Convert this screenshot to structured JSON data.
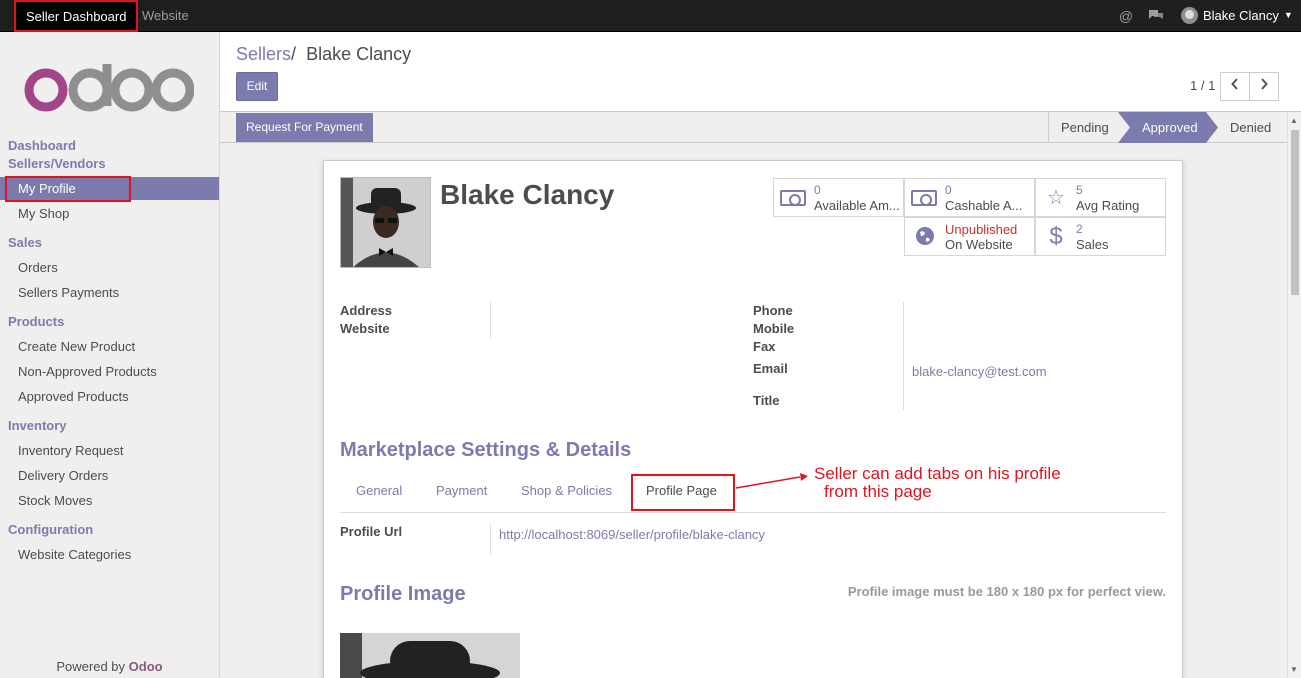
{
  "topbar": {
    "seller_dashboard": "Seller Dashboard",
    "website": "Website",
    "user_name": "Blake Clancy"
  },
  "sidebar": {
    "logo_text": "odoo",
    "categories": [
      "Dashboard",
      "Sellers/Vendors",
      "Sales",
      "Products",
      "Inventory",
      "Configuration"
    ],
    "items": {
      "my_profile": "My Profile",
      "my_shop": "My Shop",
      "orders": "Orders",
      "sellers_payments": "Sellers Payments",
      "create_new_product": "Create New Product",
      "non_approved_products": "Non-Approved Products",
      "approved_products": "Approved Products",
      "inventory_request": "Inventory Request",
      "delivery_orders": "Delivery Orders",
      "stock_moves": "Stock Moves",
      "website_categories": "Website Categories"
    },
    "powered_by": "Powered by",
    "powered_brand": "Odoo"
  },
  "control": {
    "breadcrumb_parent": "Sellers",
    "breadcrumb_sep": "/",
    "breadcrumb_current": "Blake Clancy",
    "edit_label": "Edit",
    "pager": "1 / 1"
  },
  "status": {
    "request_payment": "Request For Payment",
    "stages": {
      "pending": "Pending",
      "approved": "Approved",
      "denied": "Denied"
    },
    "active_stage": "Approved"
  },
  "sheet": {
    "name": "Blake Clancy",
    "stats": {
      "available": {
        "value": "0",
        "label": "Available Am..."
      },
      "cashable": {
        "value": "0",
        "label": "Cashable A..."
      },
      "rating": {
        "value": "5",
        "label": "Avg Rating"
      },
      "published": {
        "value": "Unpublished",
        "label": "On Website"
      },
      "sales": {
        "value": "2",
        "label": "Sales"
      }
    },
    "labels": {
      "address": "Address",
      "website": "Website",
      "phone": "Phone",
      "mobile": "Mobile",
      "fax": "Fax",
      "email": "Email",
      "title": "Title",
      "profile_url": "Profile Url"
    },
    "email": "blake-clancy@test.com",
    "marketplace_title": "Marketplace Settings & Details",
    "tabs": {
      "general": "General",
      "payment": "Payment",
      "shop_policies": "Shop & Policies",
      "profile_page": "Profile Page"
    },
    "profile_url": "http://localhost:8069/seller/profile/blake-clancy",
    "profile_image_title": "Profile Image",
    "profile_image_hint": "Profile image must be 180 x 180 px for perfect view."
  },
  "annotation": {
    "line1": "Seller can add tabs on his profile",
    "line2": "from this page"
  },
  "colors": {
    "accent": "#7c7bad",
    "highlight": "#e0141e",
    "brand": "#875a7b"
  }
}
